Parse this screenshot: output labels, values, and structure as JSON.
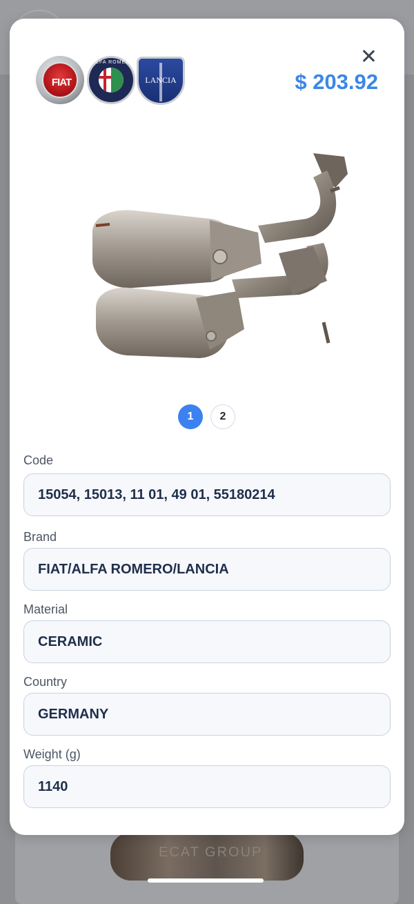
{
  "modal": {
    "price": "$ 203.92",
    "logos": {
      "fiat": "FIAT",
      "alfa_ring": "ALFA ROMEO",
      "lancia": "LANCIA"
    },
    "watermark": "ECAT GROUP",
    "pagination": [
      "1",
      "2"
    ],
    "fields": [
      {
        "label": "Code",
        "value": "15054, 15013, 11 01, 49 01, 55180214"
      },
      {
        "label": "Brand",
        "value": "FIAT/ALFA ROMERO/LANCIA"
      },
      {
        "label": "Material",
        "value": "CERAMIC"
      },
      {
        "label": "Country",
        "value": "GERMANY"
      },
      {
        "label": "Weight (g)",
        "value": "1140"
      }
    ]
  },
  "background": {
    "watermark": "ECAT GROUP"
  },
  "colors": {
    "accent": "#3b87e6",
    "active_page": "#3b82f0",
    "field_bg": "#f6f8fc",
    "field_border": "#c9d2de",
    "value_text": "#1f2e4a"
  }
}
